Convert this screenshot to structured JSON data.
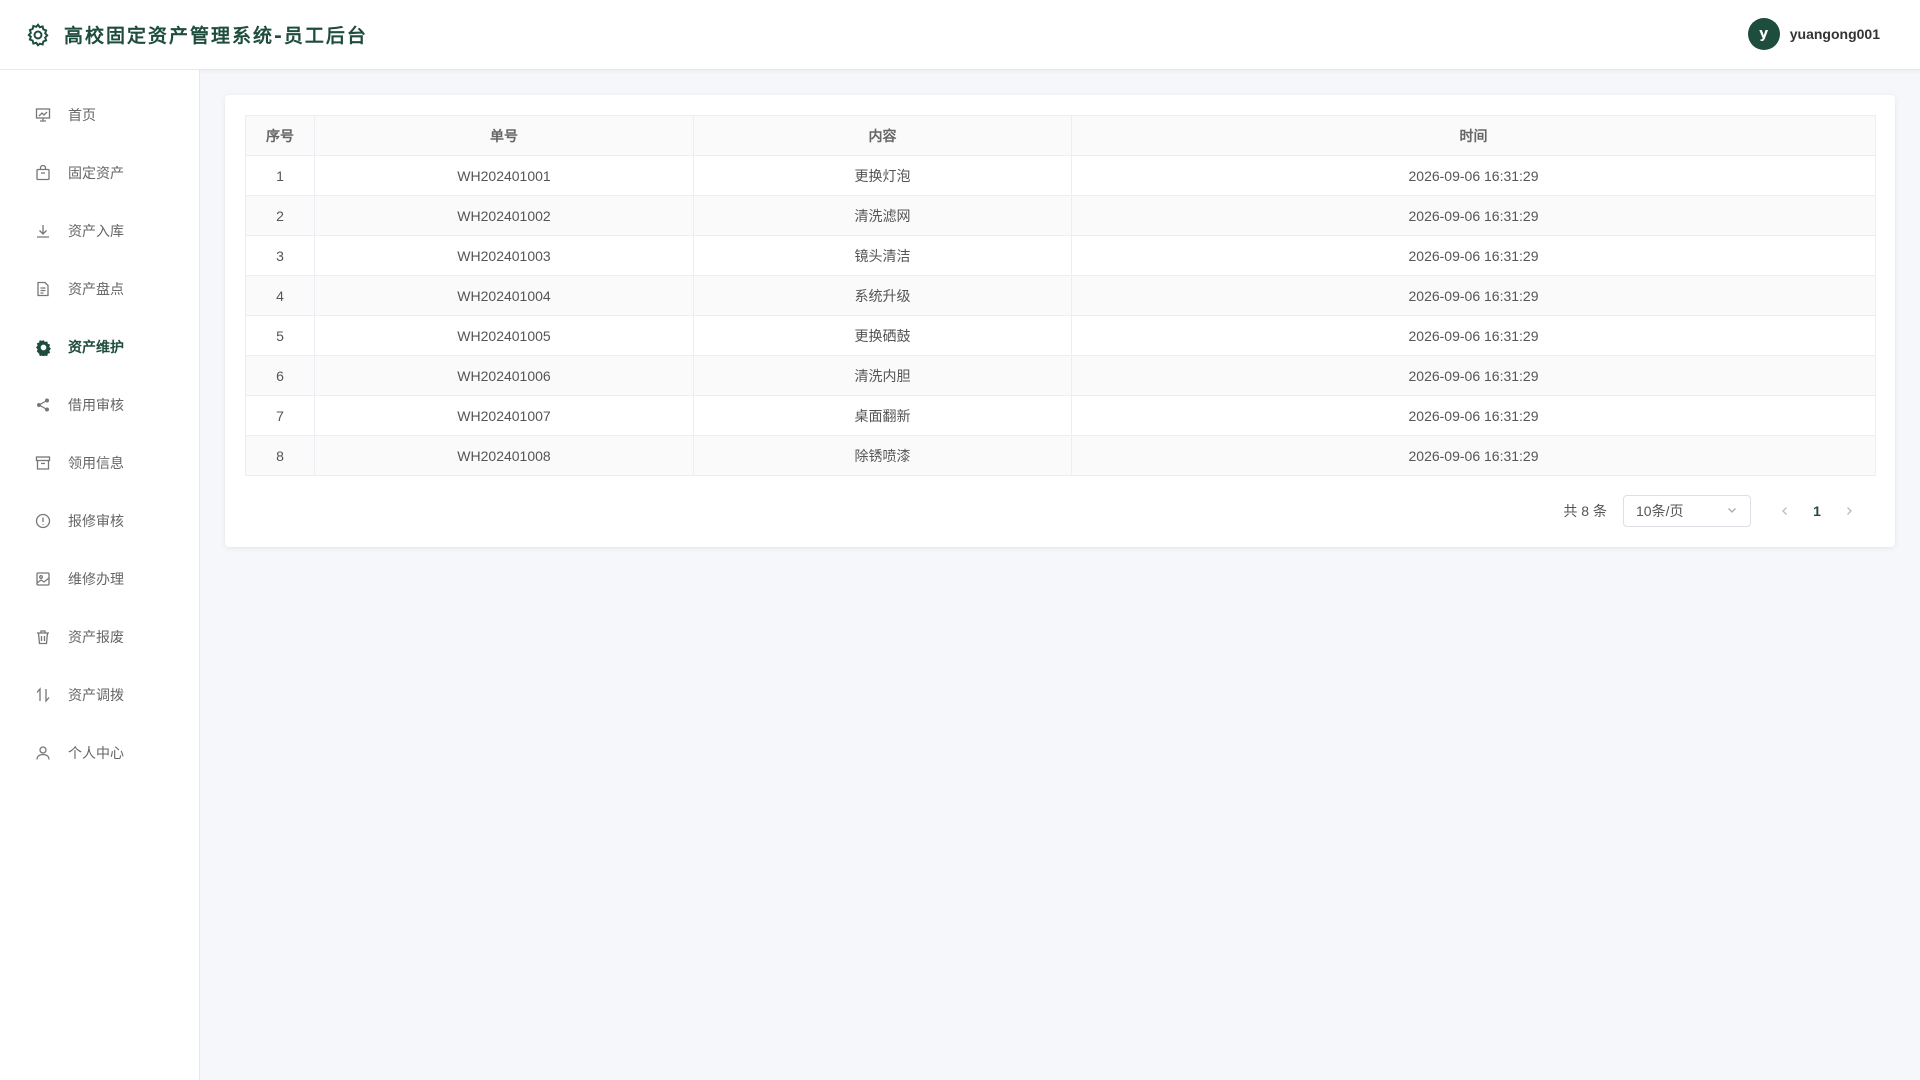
{
  "header": {
    "title": "高校固定资产管理系统-员工后台",
    "user": {
      "avatar_letter": "y",
      "username": "yuangong001"
    }
  },
  "sidebar": {
    "items": [
      {
        "label": "首页",
        "icon": "chart-board-icon",
        "active": false
      },
      {
        "label": "固定资产",
        "icon": "bag-icon",
        "active": false
      },
      {
        "label": "资产入库",
        "icon": "download-icon",
        "active": false
      },
      {
        "label": "资产盘点",
        "icon": "document-icon",
        "active": false
      },
      {
        "label": "资产维护",
        "icon": "gear-icon",
        "active": true
      },
      {
        "label": "借用审核",
        "icon": "share-icon",
        "active": false
      },
      {
        "label": "领用信息",
        "icon": "archive-box-icon",
        "active": false
      },
      {
        "label": "报修审核",
        "icon": "warning-circle-icon",
        "active": false
      },
      {
        "label": "维修办理",
        "icon": "picture-icon",
        "active": false
      },
      {
        "label": "资产报废",
        "icon": "trash-icon",
        "active": false
      },
      {
        "label": "资产调拨",
        "icon": "sort-arrows-icon",
        "active": false
      },
      {
        "label": "个人中心",
        "icon": "user-icon",
        "active": false
      }
    ]
  },
  "table": {
    "columns": [
      "序号",
      "单号",
      "内容",
      "时间"
    ],
    "rows": [
      [
        "1",
        "WH202401001",
        "更换灯泡",
        "2026-09-06 16:31:29"
      ],
      [
        "2",
        "WH202401002",
        "清洗滤网",
        "2026-09-06 16:31:29"
      ],
      [
        "3",
        "WH202401003",
        "镜头清洁",
        "2026-09-06 16:31:29"
      ],
      [
        "4",
        "WH202401004",
        "系统升级",
        "2026-09-06 16:31:29"
      ],
      [
        "5",
        "WH202401005",
        "更换硒鼓",
        "2026-09-06 16:31:29"
      ],
      [
        "6",
        "WH202401006",
        "清洗内胆",
        "2026-09-06 16:31:29"
      ],
      [
        "7",
        "WH202401007",
        "桌面翻新",
        "2026-09-06 16:31:29"
      ],
      [
        "8",
        "WH202401008",
        "除锈喷漆",
        "2026-09-06 16:31:29"
      ]
    ]
  },
  "pagination": {
    "total_text": "共 8 条",
    "page_size": "10条/页",
    "current_page": "1"
  },
  "colors": {
    "accent": "#1f4d3d",
    "background": "#f5f7fa"
  }
}
